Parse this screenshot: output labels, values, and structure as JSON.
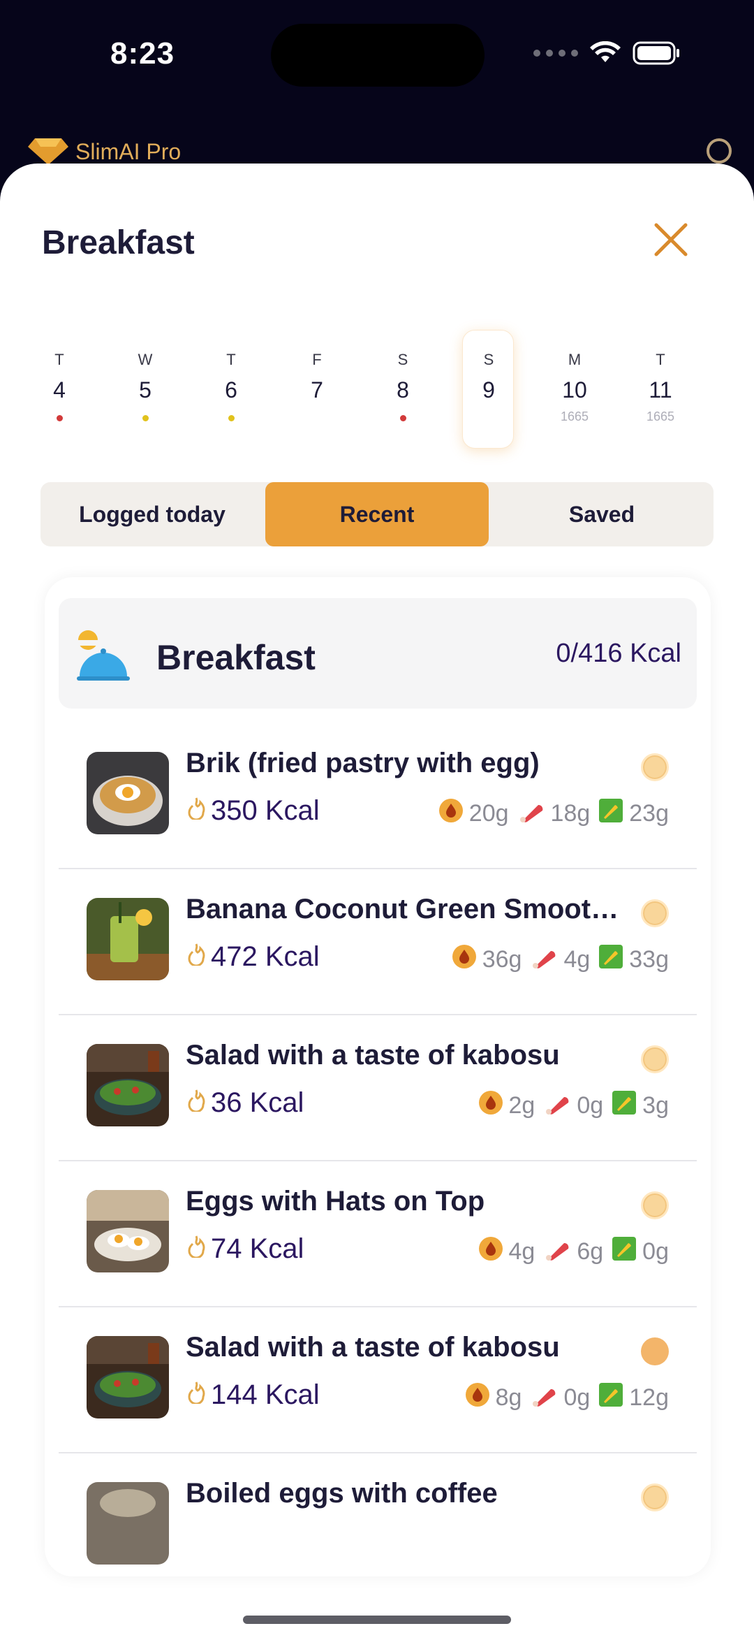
{
  "status_bar": {
    "time": "8:23"
  },
  "app_header": {
    "title": "SlimAI Pro"
  },
  "sheet": {
    "title": "Breakfast"
  },
  "days": [
    {
      "letter": "T",
      "num": "4",
      "dot": "#d23a3a",
      "sub": ""
    },
    {
      "letter": "W",
      "num": "5",
      "dot": "#e1c21c",
      "sub": ""
    },
    {
      "letter": "T",
      "num": "6",
      "dot": "#e1c21c",
      "sub": ""
    },
    {
      "letter": "F",
      "num": "7",
      "dot": "",
      "sub": ""
    },
    {
      "letter": "S",
      "num": "8",
      "dot": "#d23a3a",
      "sub": ""
    },
    {
      "letter": "S",
      "num": "9",
      "dot": "",
      "sub": "",
      "selected": true
    },
    {
      "letter": "M",
      "num": "10",
      "dot": "",
      "sub": "1665"
    },
    {
      "letter": "T",
      "num": "11",
      "dot": "",
      "sub": "1665"
    }
  ],
  "tabs": [
    {
      "label": "Logged today",
      "active": false
    },
    {
      "label": "Recent",
      "active": true
    },
    {
      "label": "Saved",
      "active": false
    }
  ],
  "meal": {
    "title": "Breakfast",
    "kcal": "0/416 Kcal",
    "items": [
      {
        "name": "Brik (fried pastry with egg)",
        "kcal": "350 Kcal",
        "fat": "20g",
        "protein": "18g",
        "carbs": "23g",
        "thumb": "pastry"
      },
      {
        "name": "Banana Coconut Green Smoothie",
        "kcal": "472 Kcal",
        "fat": "36g",
        "protein": "4g",
        "carbs": "33g",
        "thumb": "smoothie"
      },
      {
        "name": "Salad with a taste of kabosu",
        "kcal": "36 Kcal",
        "fat": "2g",
        "protein": "0g",
        "carbs": "3g",
        "thumb": "salad"
      },
      {
        "name": "Eggs with Hats on Top",
        "kcal": "74 Kcal",
        "fat": "4g",
        "protein": "6g",
        "carbs": "0g",
        "thumb": "eggs"
      },
      {
        "name": "Salad with a taste of kabosu",
        "kcal": "144 Kcal",
        "fat": "8g",
        "protein": "0g",
        "carbs": "12g",
        "thumb": "salad"
      },
      {
        "name": "Boiled eggs with coffee",
        "kcal": "",
        "fat": "",
        "protein": "",
        "carbs": "",
        "thumb": "coffee"
      }
    ]
  },
  "colors": {
    "accent": "#eba03a",
    "kcal_text": "#2b1760",
    "background": "#06051a"
  }
}
